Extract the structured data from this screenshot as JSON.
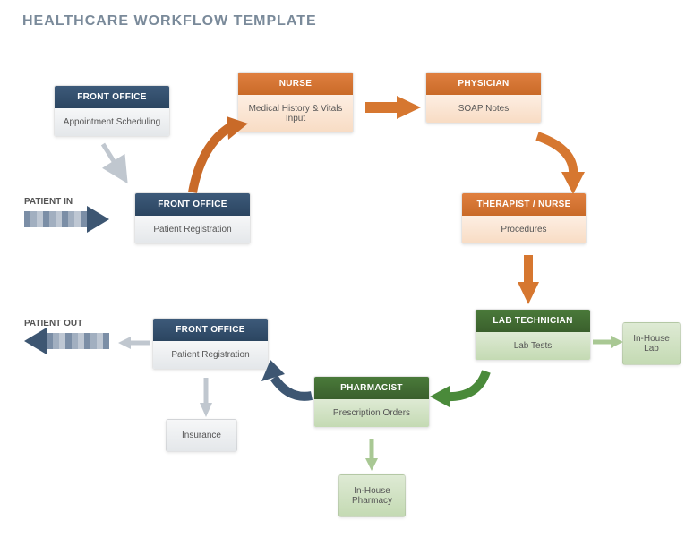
{
  "title": "HEALTHCARE WORKFLOW TEMPLATE",
  "labels": {
    "in": "PATIENT IN",
    "out": "PATIENT OUT"
  },
  "nodes": {
    "fo_appt": {
      "header": "FRONT OFFICE",
      "body": "Appointment Scheduling"
    },
    "fo_reg": {
      "header": "FRONT OFFICE",
      "body": "Patient Registration"
    },
    "nurse": {
      "header": "NURSE",
      "body": "Medical History & Vitals Input"
    },
    "physician": {
      "header": "PHYSICIAN",
      "body": "SOAP Notes"
    },
    "therapist": {
      "header": "THERAPIST / NURSE",
      "body": "Procedures"
    },
    "labtech": {
      "header": "LAB TECHNICIAN",
      "body": "Lab Tests"
    },
    "pharmacist": {
      "header": "PHARMACIST",
      "body": "Prescription Orders"
    },
    "fo_reg2": {
      "header": "FRONT OFFICE",
      "body": "Patient Registration"
    },
    "inhouse_lab": "In-House Lab",
    "inhouse_pharm": "In-House Pharmacy",
    "insurance": "Insurance"
  }
}
